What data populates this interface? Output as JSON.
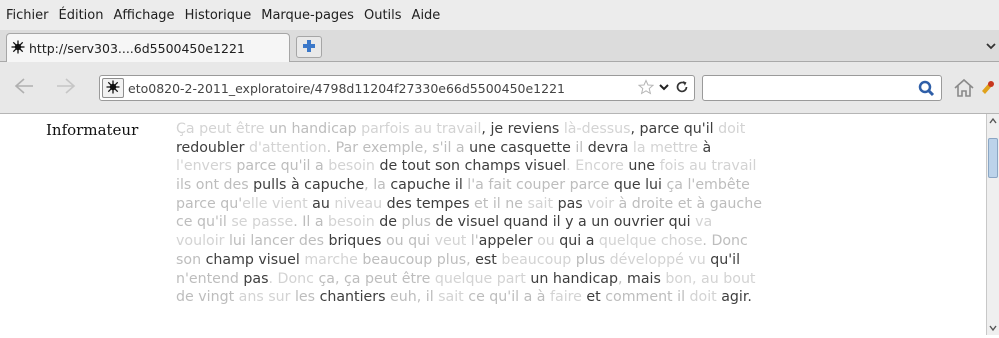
{
  "menu": {
    "items": [
      "Fichier",
      "Édition",
      "Affichage",
      "Historique",
      "Marque-pages",
      "Outils",
      "Aide"
    ]
  },
  "tabs": {
    "active_label": "http://serv303....6d5500450e1221"
  },
  "toolbar": {
    "url": "eto0820-2-2011_exploratoire/4798d11204f27330e66d5500450e1221",
    "search_value": ""
  },
  "document": {
    "speaker": "Informateur",
    "lines": [
      [
        {
          "t": "Ça peut être ",
          "s": "f"
        },
        {
          "t": "un handicap",
          "s": "m"
        },
        {
          "t": " parfois au travail",
          "s": "f"
        },
        {
          "t": ", je reviens ",
          "s": "n"
        },
        {
          "t": "là-dessus",
          "s": "f"
        },
        {
          "t": ", parce qu'il ",
          "s": "n"
        },
        {
          "t": "doit",
          "s": "f"
        }
      ],
      [
        {
          "t": "redoubler ",
          "s": "n"
        },
        {
          "t": "d'attention",
          "s": "f"
        },
        {
          "t": ". Par exemple, s'il a ",
          "s": "m"
        },
        {
          "t": "une ",
          "s": "n"
        },
        {
          "t": "casquette",
          "s": "n"
        },
        {
          "t": " ",
          "s": "n"
        },
        {
          "t": "il ",
          "s": "m"
        },
        {
          "t": "devra ",
          "s": "n"
        },
        {
          "t": "la mettre ",
          "s": "f"
        },
        {
          "t": "à",
          "s": "n"
        }
      ],
      [
        {
          "t": "l'envers ",
          "s": "f"
        },
        {
          "t": "parce qu'il a ",
          "s": "m"
        },
        {
          "t": "besoin ",
          "s": "f"
        },
        {
          "t": "de tout son ",
          "s": "n"
        },
        {
          "t": "champs visuel",
          "s": "n"
        },
        {
          "t": ". Encore ",
          "s": "f"
        },
        {
          "t": "une ",
          "s": "n"
        },
        {
          "t": "fois au travail",
          "s": "f"
        }
      ],
      [
        {
          "t": "ils ont des ",
          "s": "m"
        },
        {
          "t": "pulls à capuche",
          "s": "n"
        },
        {
          "t": ", la ",
          "s": "m"
        },
        {
          "t": "capuche ",
          "s": "n"
        },
        {
          "t": "il ",
          "s": "n"
        },
        {
          "t": "l'a fait couper parce ",
          "s": "m"
        },
        {
          "t": "que lui ",
          "s": "n"
        },
        {
          "t": "ça l'embête",
          "s": "m"
        }
      ],
      [
        {
          "t": "parce qu'",
          "s": "m"
        },
        {
          "t": "elle vient ",
          "s": "f"
        },
        {
          "t": "au ",
          "s": "n"
        },
        {
          "t": "niveau ",
          "s": "f"
        },
        {
          "t": "des ",
          "s": "n"
        },
        {
          "t": "tempes ",
          "s": "n"
        },
        {
          "t": "et il ne ",
          "s": "m"
        },
        {
          "t": "sait ",
          "s": "f"
        },
        {
          "t": "pas ",
          "s": "n"
        },
        {
          "t": "voir ",
          "s": "f"
        },
        {
          "t": "à droite et à gauche",
          "s": "m"
        }
      ],
      [
        {
          "t": "ce qu'il ",
          "s": "m"
        },
        {
          "t": "se passe",
          "s": "f"
        },
        {
          "t": ". Il a ",
          "s": "m"
        },
        {
          "t": "besoin ",
          "s": "f"
        },
        {
          "t": "de ",
          "s": "n"
        },
        {
          "t": "plus ",
          "s": "m"
        },
        {
          "t": "de visuel quand il y a un ouvrier qui ",
          "s": "n"
        },
        {
          "t": "va",
          "s": "f"
        }
      ],
      [
        {
          "t": "vouloir ",
          "s": "f"
        },
        {
          "t": "lui lancer des ",
          "s": "m"
        },
        {
          "t": "briques ",
          "s": "n"
        },
        {
          "t": "ou qui ",
          "s": "m"
        },
        {
          "t": "veut ",
          "s": "f"
        },
        {
          "t": "l'",
          "s": "m"
        },
        {
          "t": "appeler ",
          "s": "n"
        },
        {
          "t": "ou ",
          "s": "f"
        },
        {
          "t": "qui a ",
          "s": "n"
        },
        {
          "t": "quelque chose",
          "s": "f"
        },
        {
          "t": ". Donc",
          "s": "m"
        }
      ],
      [
        {
          "t": "son ",
          "s": "m"
        },
        {
          "t": "champ visuel ",
          "s": "n"
        },
        {
          "t": "marche ",
          "s": "f"
        },
        {
          "t": "beaucoup plus, ",
          "s": "m"
        },
        {
          "t": "est ",
          "s": "n"
        },
        {
          "t": "beaucoup ",
          "s": "f"
        },
        {
          "t": "plus ",
          "s": "m"
        },
        {
          "t": "développé vu ",
          "s": "f"
        },
        {
          "t": "qu'il",
          "s": "n"
        }
      ],
      [
        {
          "t": "n'entend ",
          "s": "m"
        },
        {
          "t": "pas",
          "s": "n"
        },
        {
          "t": ". Donc ",
          "s": "f"
        },
        {
          "t": "ça, ça peut être ",
          "s": "m"
        },
        {
          "t": "quelque part ",
          "s": "f"
        },
        {
          "t": "un handicap",
          "s": "n"
        },
        {
          "t": ", ",
          "s": "m"
        },
        {
          "t": "mais ",
          "s": "n"
        },
        {
          "t": "bon, au bout",
          "s": "f"
        }
      ],
      [
        {
          "t": "de vingt ",
          "s": "m"
        },
        {
          "t": "ans sur ",
          "s": "f"
        },
        {
          "t": "les ",
          "s": "m"
        },
        {
          "t": "chantiers ",
          "s": "n"
        },
        {
          "t": "euh, il ",
          "s": "m"
        },
        {
          "t": "sait ",
          "s": "f"
        },
        {
          "t": "ce qu'il a à ",
          "s": "m"
        },
        {
          "t": "faire ",
          "s": "f"
        },
        {
          "t": "et ",
          "s": "n"
        },
        {
          "t": "comment il ",
          "s": "m"
        },
        {
          "t": "doit ",
          "s": "f"
        },
        {
          "t": "agir.",
          "s": "n"
        }
      ]
    ]
  }
}
